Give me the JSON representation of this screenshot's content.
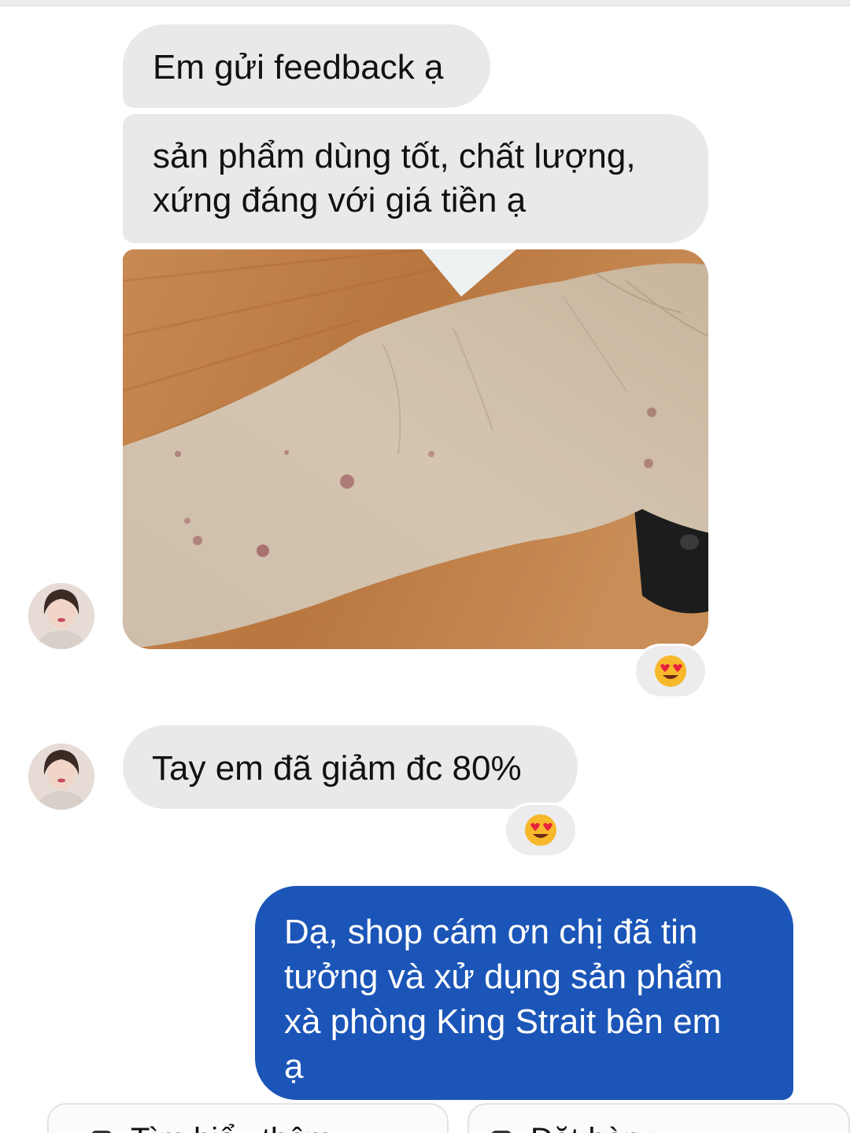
{
  "conversation": {
    "incoming": [
      {
        "text": "Em gửi feedback ạ"
      },
      {
        "lines": [
          "sản phẩm dùng tốt, chất lượng,",
          "xứng đáng với giá tiền ạ"
        ]
      },
      {
        "text": "Tay em đã giảm đc 80%"
      }
    ],
    "photo_icon": "skin-rash-photo",
    "reactions": [
      {
        "icon": "heart-eyes-emoji-icon"
      },
      {
        "icon": "heart-eyes-emoji-icon"
      }
    ],
    "outgoing": {
      "lines": [
        "Dạ, shop cám ơn chị đã tin",
        "tưởng và xử dụng sản phẩm",
        "xà phòng King Strait bên em",
        "ạ"
      ]
    }
  },
  "quick_replies": [
    {
      "label": "Tìm hiểu thêm",
      "icon": "chat-icon"
    },
    {
      "label": "Đặt hàng",
      "icon": "bag-icon"
    }
  ],
  "colors": {
    "incoming_bubble": "#e9e9eb",
    "outgoing_bubble": "#1b55b8",
    "outgoing_text": "#ffffff"
  }
}
